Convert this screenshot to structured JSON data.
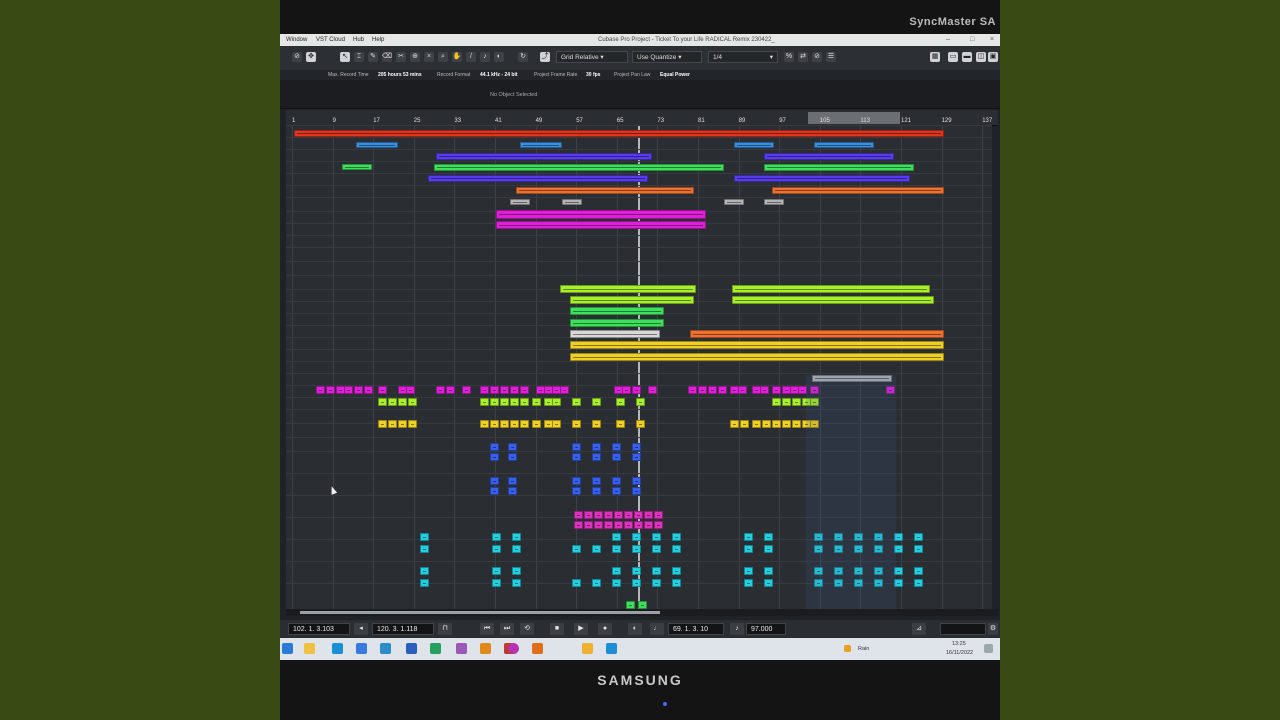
{
  "monitor": {
    "brand_top": "SyncMaster SA",
    "brand_bottom": "SAMSUNG"
  },
  "menu": {
    "items": [
      "Window",
      "VST Cloud",
      "Hub",
      "Help"
    ],
    "window_title": "Cubase Pro Project - Ticket To your Life RADICAL Remix 230422_"
  },
  "toolbar": {
    "grid_mode": "Grid Relative",
    "quantize_mode": "Use Quantize",
    "quantize_value": "1/4"
  },
  "info": {
    "max_record_label": "Max. Record Time",
    "max_record_value": "205 hours 53 mins",
    "format_label": "Record Format",
    "format_value": "44.1 kHz - 24 bit",
    "frame_rate_label": "Project Frame Rate",
    "frame_rate_value": "30 fps",
    "pan_law_label": "Project Pan Law",
    "pan_law_value": "Equal Power"
  },
  "inspector": {
    "status": "No Object Selected"
  },
  "ruler": {
    "bars": [
      "1",
      "9",
      "17",
      "25",
      "33",
      "41",
      "49",
      "57",
      "65",
      "73",
      "81",
      "89",
      "97",
      "105",
      "113",
      "121",
      "129",
      "137"
    ]
  },
  "transport": {
    "left_locator": "102. 1. 3.103",
    "right_locator": "120. 3. 1.118",
    "position": "69. 1. 3. 10",
    "tempo": "97.000"
  },
  "taskbar": {
    "weather": "Rain",
    "time": "13:25",
    "date": "16/11/2022"
  },
  "colors": {
    "red": "#e0351e",
    "blue": "#3a8fe0",
    "violet": "#5a3cf0",
    "green": "#3de05a",
    "orange": "#f07030",
    "gray": "#b4b4b4",
    "magenta": "#e020d8",
    "lime": "#a8f028",
    "yellow": "#f0d020",
    "white": "#d8d8d8",
    "pink": "#e030c0",
    "royal": "#3860f0",
    "cyan": "#20d0e0",
    "bg": "#2a2e33"
  }
}
